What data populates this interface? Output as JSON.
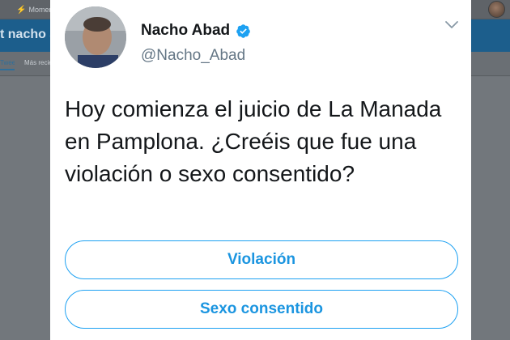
{
  "background": {
    "nav_item_label": "Moment",
    "banner_title": "t nacho a",
    "tabs": [
      "Tweets",
      "Más reciente"
    ]
  },
  "tweet": {
    "author_name": "Nacho Abad",
    "author_handle": "@Nacho_Abad",
    "verified": true,
    "text": "Hoy comienza el juicio de La Manada en Pamplona. ¿Creéis que fue una violación o sexo consentido?",
    "poll_options": [
      "Violación",
      "Sexo consentido"
    ]
  },
  "colors": {
    "accent": "#1da1f2",
    "poll_text": "#1b95e0",
    "overlay": "#6e7378"
  }
}
